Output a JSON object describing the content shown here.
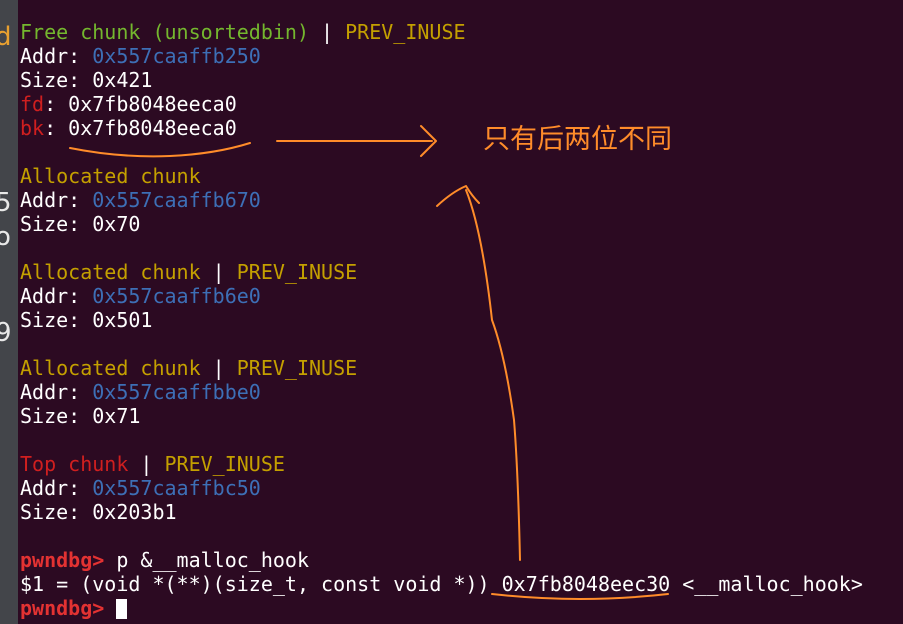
{
  "left_strip_chars": [
    "d",
    "5",
    "o",
    "9"
  ],
  "chunks": [
    {
      "title": "Free chunk (unsortedbin)",
      "sep": " | ",
      "flag": "PREV_INUSE",
      "addr_label": "Addr: ",
      "addr": "0x557caaffb250",
      "size_label": "Size: ",
      "size": "0x421",
      "fd_label": "fd",
      "fd_rest": ": 0x7fb8048eeca0",
      "bk_label": "bk",
      "bk_rest": ": 0x7fb8048eeca0"
    },
    {
      "title": "Allocated chunk",
      "addr_label": "Addr: ",
      "addr": "0x557caaffb670",
      "size_label": "Size: ",
      "size": "0x70"
    },
    {
      "title": "Allocated chunk",
      "sep": " | ",
      "flag": "PREV_INUSE",
      "addr_label": "Addr: ",
      "addr": "0x557caaffb6e0",
      "size_label": "Size: ",
      "size": "0x501"
    },
    {
      "title": "Allocated chunk",
      "sep": " | ",
      "flag": "PREV_INUSE",
      "addr_label": "Addr: ",
      "addr": "0x557caaffbbe0",
      "size_label": "Size: ",
      "size": "0x71"
    },
    {
      "title": "Top chunk",
      "sep": " | ",
      "flag": "PREV_INUSE",
      "addr_label": "Addr: ",
      "addr": "0x557caaffbc50",
      "size_label": "Size: ",
      "size": "0x203b1"
    }
  ],
  "prompt": "pwndbg> ",
  "command": "p &__malloc_hook",
  "result_prefix": "$1 = (void *(**)(size_t, const void *)) ",
  "result_addr": "0x7fb8048eec30",
  "result_suffix": " <__malloc_hook>",
  "annotation": {
    "note": "只有后两位不同",
    "color": "#ff8c2a"
  },
  "colors": {
    "background": "#2c0a22",
    "free_title": "#74b72e",
    "allocated_title": "#c4a000",
    "top_title": "#d01f1f",
    "address": "#3d6fb6",
    "prompt": "#e33232"
  }
}
